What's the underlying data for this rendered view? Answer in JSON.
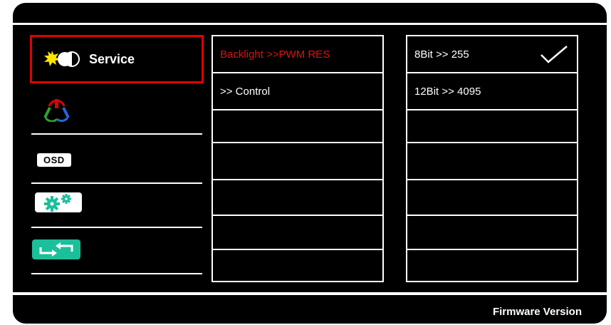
{
  "sidebar": {
    "items": [
      {
        "id": "service",
        "label": "Service",
        "icon": "brightness-contrast-icon",
        "selected": true
      },
      {
        "id": "color",
        "icon": "color-rgb-icon"
      },
      {
        "id": "osd",
        "label": "OSD",
        "icon": "osd-icon"
      },
      {
        "id": "settings",
        "icon": "gears-icon"
      },
      {
        "id": "reset",
        "icon": "reset-arrows-icon"
      }
    ]
  },
  "submenu": {
    "items": [
      {
        "label": "Backlight >>PWM RES",
        "active": true
      },
      {
        "label": ">> Control"
      },
      {
        "label": ""
      },
      {
        "label": ""
      },
      {
        "label": ""
      },
      {
        "label": ""
      },
      {
        "label": ""
      }
    ]
  },
  "options": {
    "items": [
      {
        "label": "8Bit >> 255",
        "checked": true
      },
      {
        "label": "12Bit >> 4095"
      },
      {
        "label": ""
      },
      {
        "label": ""
      },
      {
        "label": ""
      },
      {
        "label": ""
      },
      {
        "label": ""
      }
    ]
  },
  "footer": {
    "label": "Firmware Version"
  },
  "colors": {
    "accent_red": "#e00000",
    "teal": "#1bbf9a",
    "background": "#000000"
  }
}
